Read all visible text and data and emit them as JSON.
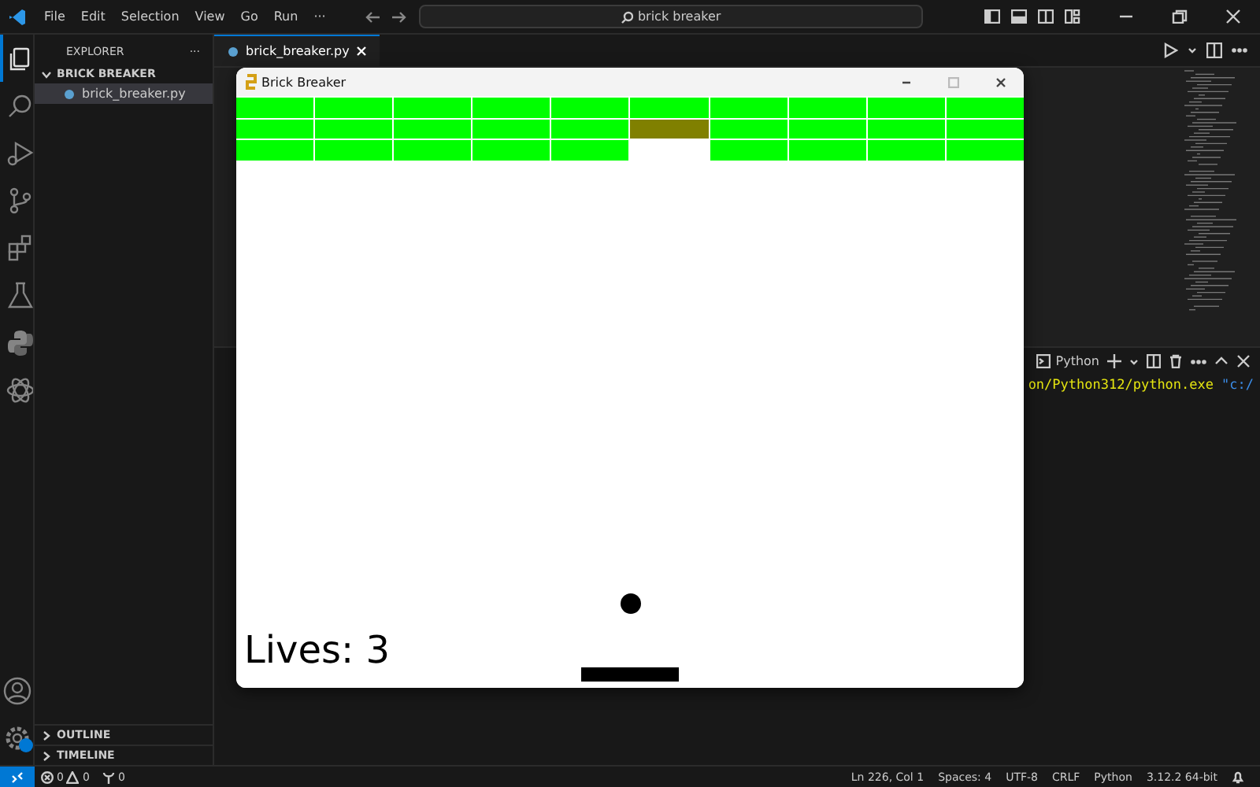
{
  "title_bar": {
    "menus": [
      "File",
      "Edit",
      "Selection",
      "View",
      "Go",
      "Run",
      "···"
    ],
    "search": "brick breaker"
  },
  "activity_bar": {
    "items": [
      {
        "kind": "files",
        "selected": true
      },
      {
        "kind": "search",
        "selected": false
      },
      {
        "kind": "debug",
        "selected": false
      },
      {
        "kind": "git",
        "selected": false
      },
      {
        "kind": "extensions",
        "selected": false
      },
      {
        "kind": "flask",
        "selected": false
      },
      {
        "kind": "python",
        "selected": false
      },
      {
        "kind": "atom",
        "selected": false
      }
    ]
  },
  "sidebar": {
    "title": "EXPLORER",
    "more": "···",
    "folder": {
      "name": "BRICK BREAKER",
      "expanded": true,
      "files": [
        {
          "name": "brick_breaker.py",
          "selected": true
        }
      ]
    },
    "sections": [
      {
        "name": "OUTLINE",
        "expanded": false
      },
      {
        "name": "TIMELINE",
        "expanded": false
      }
    ]
  },
  "editor": {
    "tabs": [
      {
        "label": "brick_breaker.py",
        "selected": true
      }
    ]
  },
  "terminal": {
    "shell": "Python",
    "line": [
      {
        "kind": "path",
        "text": "on/Python312/python.exe"
      },
      {
        "kind": "string",
        "text": "\"c:/"
      }
    ]
  },
  "game_window": {
    "title": "Brick Breaker",
    "bricks": [
      [
        {
          "kind": "intact"
        },
        {
          "kind": "intact"
        },
        {
          "kind": "intact"
        },
        {
          "kind": "intact"
        },
        {
          "kind": "intact"
        },
        {
          "kind": "intact"
        },
        {
          "kind": "intact"
        },
        {
          "kind": "intact"
        },
        {
          "kind": "intact"
        },
        {
          "kind": "intact"
        }
      ],
      [
        {
          "kind": "intact"
        },
        {
          "kind": "intact"
        },
        {
          "kind": "intact"
        },
        {
          "kind": "intact"
        },
        {
          "kind": "intact"
        },
        {
          "kind": "cracked"
        },
        {
          "kind": "intact"
        },
        {
          "kind": "intact"
        },
        {
          "kind": "intact"
        },
        {
          "kind": "intact"
        }
      ],
      [
        {
          "kind": "intact"
        },
        {
          "kind": "intact"
        },
        {
          "kind": "intact"
        },
        {
          "kind": "intact"
        },
        {
          "kind": "intact"
        },
        {
          "kind": "broken"
        },
        {
          "kind": "intact"
        },
        {
          "kind": "intact"
        },
        {
          "kind": "intact"
        },
        {
          "kind": "intact"
        }
      ]
    ],
    "lives": "Lives: 3"
  },
  "status_bar": {
    "errors": "0",
    "warnings": "0",
    "ports": "0",
    "items": [
      "Ln 226, Col 1",
      "Spaces: 4",
      "UTF-8",
      "CRLF",
      "Python",
      "3.12.2 64-bit"
    ]
  }
}
